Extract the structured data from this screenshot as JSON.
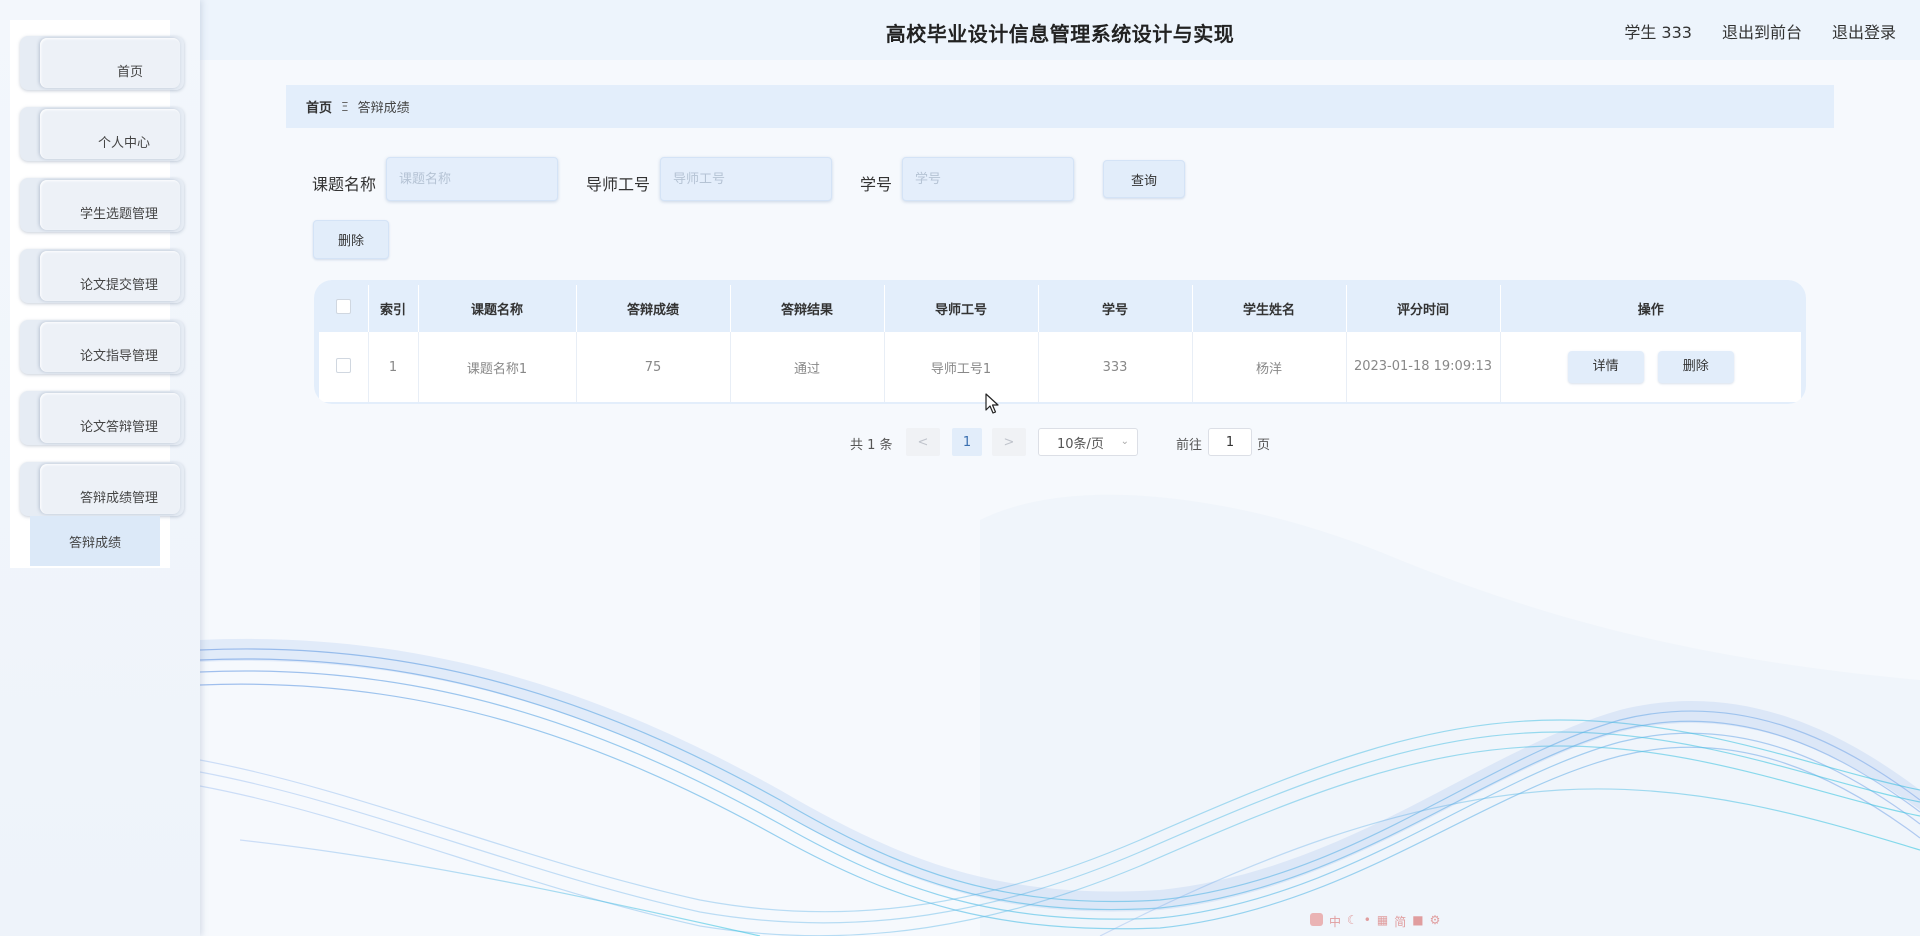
{
  "header": {
    "title": "高校毕业设计信息管理系统设计与实现",
    "user_label": "学生 333",
    "front_link": "退出到前台",
    "logout_link": "退出登录"
  },
  "sidebar": {
    "items": [
      {
        "label": "首页"
      },
      {
        "label": "个人中心"
      },
      {
        "label": "学生选题管理"
      },
      {
        "label": "论文提交管理"
      },
      {
        "label": "论文指导管理"
      },
      {
        "label": "论文答辩管理"
      },
      {
        "label": "答辩成绩管理"
      }
    ],
    "submenu": {
      "label": "答辩成绩"
    }
  },
  "breadcrumb": {
    "home": "首页",
    "separator": "Ξ",
    "current": "答辩成绩"
  },
  "search": {
    "topic_label": "课题名称",
    "topic_placeholder": "课题名称",
    "teacher_label": "导师工号",
    "teacher_placeholder": "导师工号",
    "student_label": "学号",
    "student_placeholder": "学号",
    "query_button": "查询"
  },
  "actions": {
    "delete_button": "删除"
  },
  "table": {
    "columns": [
      "索引",
      "课题名称",
      "答辩成绩",
      "答辩结果",
      "导师工号",
      "学号",
      "学生姓名",
      "评分时间",
      "操作"
    ],
    "rows": [
      {
        "index": "1",
        "topic": "课题名称1",
        "score": "75",
        "result": "通过",
        "teacher_id": "导师工号1",
        "student_id": "333",
        "student_name": "杨洋",
        "time": "2023-01-18 19:09:13",
        "detail_label": "详情",
        "delete_label": "删除"
      }
    ]
  },
  "pagination": {
    "total": "共 1 条",
    "prev": "<",
    "current_page": "1",
    "next": ">",
    "page_size": "10条/页",
    "goto_label": "前往",
    "goto_value": "1",
    "page_suffix": "页"
  },
  "tray": {
    "items": [
      "中",
      "简"
    ]
  }
}
